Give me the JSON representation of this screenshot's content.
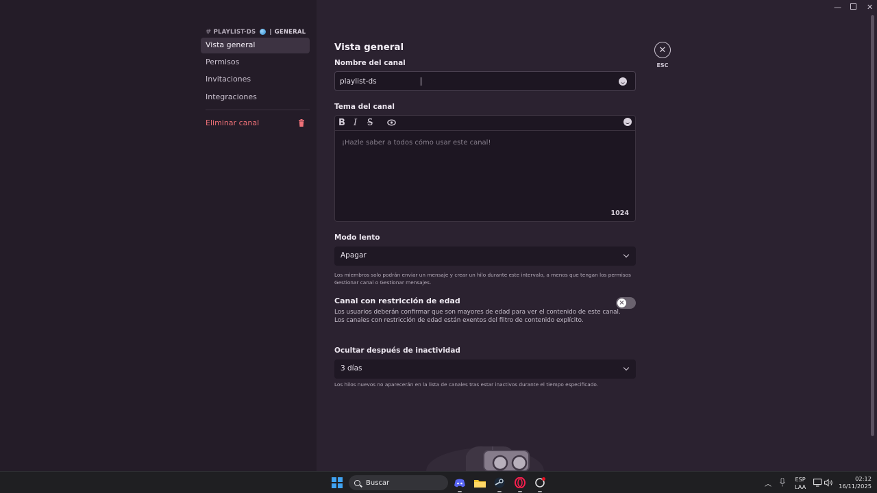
{
  "sidebar": {
    "channel_name": "PLAYLIST-DS",
    "category": "GENERAL",
    "items": [
      {
        "label": "Vista general",
        "active": true
      },
      {
        "label": "Permisos"
      },
      {
        "label": "Invitaciones"
      },
      {
        "label": "Integraciones"
      }
    ],
    "delete_label": "Eliminar canal"
  },
  "main": {
    "title": "Vista general",
    "channel_name_label": "Nombre del canal",
    "channel_name_value": "playlist-ds",
    "topic_label": "Tema del canal",
    "topic_placeholder": "¡Hazle saber a todos cómo usar este canal!",
    "topic_counter": "1024",
    "slowmode_label": "Modo lento",
    "slowmode_value": "Apagar",
    "slowmode_help": "Los miembros solo podrán enviar un mensaje y crear un hilo durante este intervalo, a menos que tengan los permisos Gestionar canal o Gestionar mensajes.",
    "age_title": "Canal con restricción de edad",
    "age_desc_1": "Los usuarios deberán confirmar que son mayores de edad para ver el contenido de este canal.",
    "age_desc_2": "Los canales con restricción de edad están exentos del filtro de contenido explícito.",
    "age_enabled": false,
    "inactivity_label": "Ocultar después de inactividad",
    "inactivity_value": "3 días",
    "inactivity_help": "Los hilos nuevos no aparecerán en la lista de canales tras estar inactivos durante el tiempo especificado.",
    "esc_label": "ESC"
  },
  "taskbar": {
    "search_placeholder": "Buscar",
    "lang_1": "ESP",
    "lang_2": "LAA",
    "time": "02:12",
    "date": "16/11/2025"
  },
  "colors": {
    "accent_danger": "#f07178",
    "windows_blue": "#3fa3f2"
  }
}
